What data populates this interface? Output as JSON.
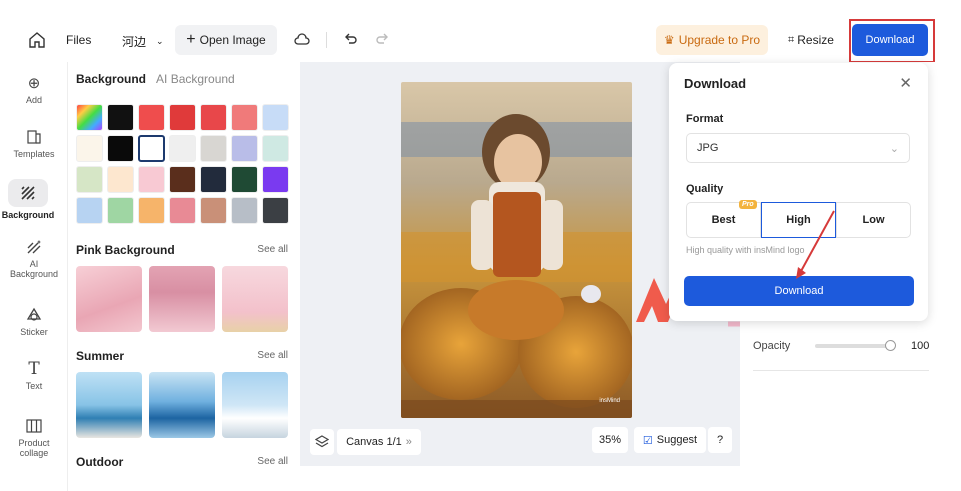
{
  "toolbar": {
    "files_label": "Files",
    "project_label": "河边",
    "open_image_label": "Open Image",
    "upgrade_label": "Upgrade to Pro",
    "resize_label": "Resize",
    "download_label": "Download"
  },
  "nav": [
    {
      "label": "Add",
      "icon": "plus-circle-icon"
    },
    {
      "label": "Templates",
      "icon": "templates-icon"
    },
    {
      "label": "Background",
      "icon": "background-icon"
    },
    {
      "label": "AI Background",
      "icon": "ai-background-icon"
    },
    {
      "label": "Sticker",
      "icon": "sticker-icon"
    },
    {
      "label": "Text",
      "icon": "text-icon"
    },
    {
      "label": "Product collage",
      "icon": "collage-icon"
    }
  ],
  "panel": {
    "tab_background": "Background",
    "tab_ai_background": "AI Background",
    "swatches": [
      "rainbow",
      "#111111",
      "#ef4d4d",
      "#e03a3a",
      "#e8474a",
      "#f07a7a",
      "#c7dcf7",
      "#fbf5ea",
      "#0a0a0a",
      "#ffffff",
      "#efefef",
      "#d8d6d2",
      "#b9bde8",
      "#cfe9e3",
      "#d6e6c6",
      "#fde7cf",
      "#f8c9d3",
      "#5a2e1c",
      "#222b3c",
      "#1f4a34",
      "#7a3af0",
      "#b7d3f2",
      "#9fd6a3",
      "#f6b46a",
      "#e88a95",
      "#c99078",
      "#b7bec7",
      "#3b3f44"
    ],
    "sections": [
      {
        "title": "Pink Background",
        "see_all": "See all"
      },
      {
        "title": "Summer",
        "see_all": "See all"
      },
      {
        "title": "Outdoor",
        "see_all": "See all"
      }
    ]
  },
  "canvas": {
    "label": "Canvas 1/1",
    "zoom": "35%",
    "suggest": "Suggest",
    "help": "?",
    "image_watermark": "insMind"
  },
  "right_panel": {
    "opacity_label": "Opacity",
    "opacity_value": "100"
  },
  "download_panel": {
    "title": "Download",
    "format_label": "Format",
    "format_value": "JPG",
    "quality_label": "Quality",
    "options": [
      "Best",
      "High",
      "Low"
    ],
    "pro_badge": "Pro",
    "note": "High quality with insMind logo",
    "button": "Download"
  },
  "colors": {
    "accent": "#1d5adc",
    "upgrade_bg": "#fdf0de",
    "upgrade_text": "#c96a10",
    "highlight_red": "#d63a3a"
  }
}
